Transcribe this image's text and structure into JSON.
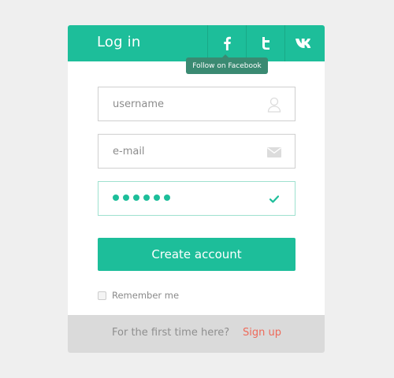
{
  "header": {
    "title": "Log in",
    "social": [
      {
        "name": "facebook",
        "icon": "facebook-icon"
      },
      {
        "name": "twitter",
        "icon": "twitter-icon"
      },
      {
        "name": "vk",
        "icon": "vk-icon"
      }
    ],
    "tooltip": "Follow on Facebook"
  },
  "form": {
    "username": {
      "placeholder": "username",
      "icon": "user-icon"
    },
    "email": {
      "placeholder": "e-mail",
      "icon": "envelope-icon"
    },
    "password": {
      "masked_length": 6,
      "icon": "checkmark-icon",
      "state": "valid"
    },
    "submit_label": "Create account",
    "remember_label": "Remember me",
    "remember_checked": false
  },
  "footer": {
    "text": "For the first time here?",
    "link": "Sign up"
  },
  "colors": {
    "accent": "#1dbe9a",
    "background": "#efefef",
    "footer": "#dadada",
    "link": "#ee6a5a",
    "tooltip": "#3a8a72"
  }
}
